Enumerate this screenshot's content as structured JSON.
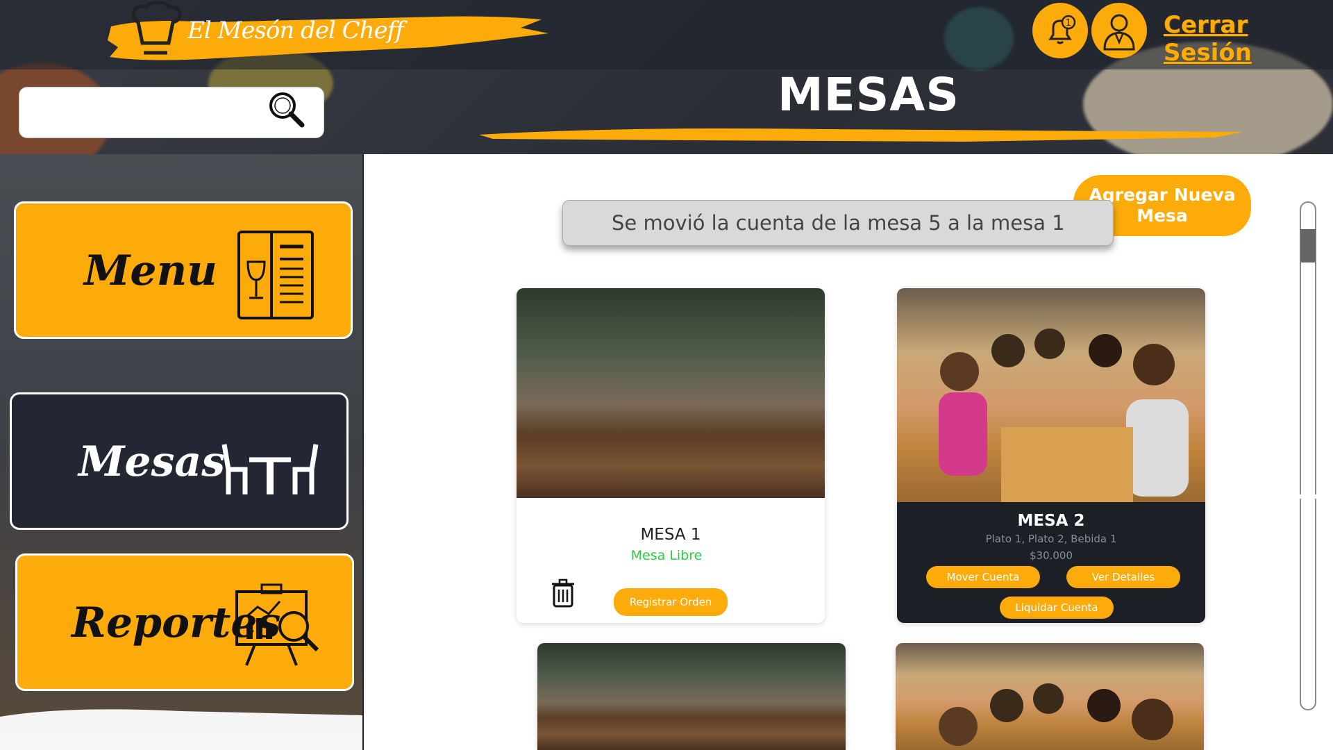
{
  "brand": {
    "logo_text": "El Mesón del Cheff",
    "accent_color": "#fcab0a",
    "dark_color": "#232734"
  },
  "header": {
    "title": "MESAS",
    "notification_icon": "bell-icon",
    "notification_count": "1",
    "user_icon": "chef-user-icon",
    "logout_label": "Cerrar Sesión"
  },
  "search": {
    "value": "",
    "placeholder": "",
    "icon": "magnifier-icon"
  },
  "sidebar": {
    "items": [
      {
        "label": "Menu",
        "icon": "menu-book-icon",
        "active": false
      },
      {
        "label": "Mesas",
        "icon": "table-chairs-icon",
        "active": true
      },
      {
        "label": "Reportes",
        "icon": "report-chart-icon",
        "active": false
      }
    ]
  },
  "main": {
    "add_button_label": "Agregar Nueva Mesa",
    "toast_message": "Se movió la cuenta de la mesa 5 a la mesa 1",
    "tables": [
      {
        "name": "MESA 1",
        "status": "Mesa Libre",
        "status_color": "#2ecc40",
        "delete_icon": "trash-icon",
        "register_label": "Registrar Orden"
      },
      {
        "name": "MESA 2",
        "items": "Plato 1, Plato 2, Bebida 1",
        "total": "$30.000",
        "move_label": "Mover Cuenta",
        "details_label": "Ver Detalles",
        "settle_label": "Liquidar Cuenta"
      }
    ]
  }
}
